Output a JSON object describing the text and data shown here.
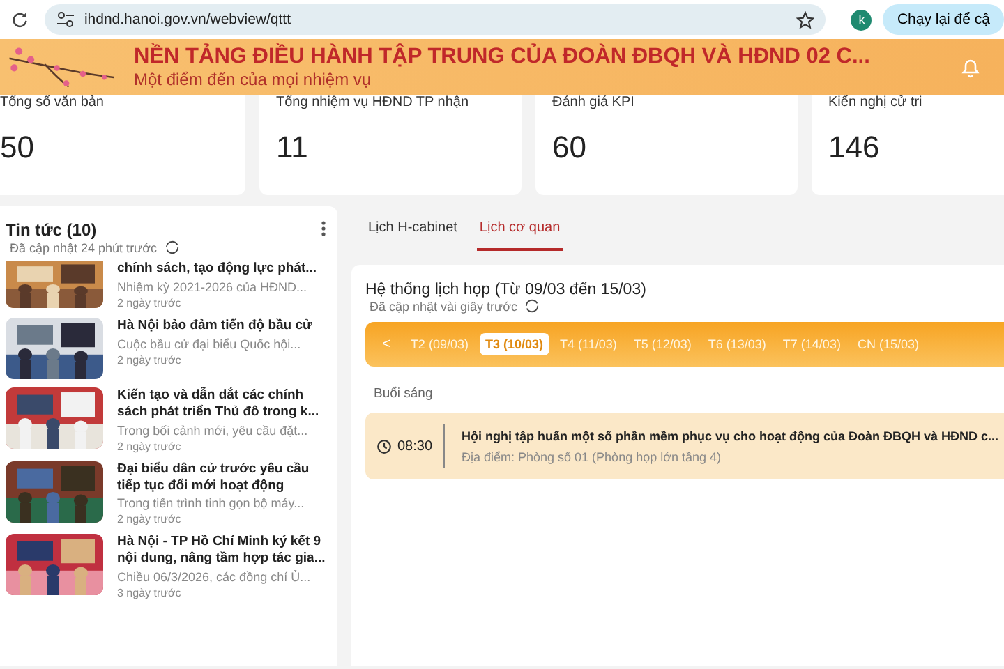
{
  "browser": {
    "url": "ihdnd.hanoi.gov.vn/webview/qttt",
    "avatar": "k",
    "action": "Chạy lại để cậ"
  },
  "header": {
    "title": "NỀN TẢNG ĐIỀU HÀNH TẬP TRUNG CỦA ĐOÀN ĐBQH VÀ HĐND 02 C...",
    "subtitle": "Một điểm đến của mọi nhiệm vụ"
  },
  "stats": [
    {
      "label": "Tổng số văn bản",
      "value": "50"
    },
    {
      "label": "Tổng nhiệm vụ HĐND TP nhận",
      "value": "11"
    },
    {
      "label": "Đánh giá KPI",
      "value": "60"
    },
    {
      "label": "Kiến nghị cử tri",
      "value": "146"
    }
  ],
  "news": {
    "title": "Tin tức (10)",
    "updated": "Đã cập nhật 24 phút trước",
    "items": [
      {
        "title": "chính sách, tạo động lực phát...",
        "summary": "Nhiệm kỳ 2021-2026 của HĐND...",
        "time": "2 ngày trước",
        "kind": "picture"
      },
      {
        "title": "Hà Nội bảo đảm tiến độ bầu cử",
        "summary": "Cuộc bầu cử đại biểu Quốc hội...",
        "time": "2 ngày trước",
        "kind": "picture"
      },
      {
        "title": "Kiến tạo và dẫn dắt các chính sách phát triển Thủ đô trong k...",
        "summary": "Trong bối cảnh mới, yêu cầu đặt...",
        "time": "2 ngày trước",
        "kind": "picture"
      },
      {
        "title": "Đại biểu dân cử trước yêu cầu tiếp tục đổi mới hoạt động",
        "summary": "Trong tiến trình tinh gọn bộ máy...",
        "time": "2 ngày trước",
        "kind": "picture"
      },
      {
        "title": "Hà Nội - TP Hồ Chí Minh ký kết 9 nội dung, nâng tầm hợp tác gia...",
        "summary": "Chiều 06/3/2026, các đồng chí Ủ...",
        "time": "3 ngày trước",
        "kind": "picture"
      }
    ]
  },
  "tabs": [
    {
      "label": "Lịch H-cabinet",
      "selected": false
    },
    {
      "label": "Lịch cơ quan",
      "selected": true
    }
  ],
  "schedule": {
    "title": "Hệ thống lịch họp (Từ 09/03 đến 15/03)",
    "updated": "Đã cập nhật vài giây trước",
    "prev": "<",
    "days": [
      {
        "label": "T2 (09/03)",
        "selected": false
      },
      {
        "label": "T3 (10/03)",
        "selected": true
      },
      {
        "label": "T4 (11/03)",
        "selected": false
      },
      {
        "label": "T5 (12/03)",
        "selected": false
      },
      {
        "label": "T6 (13/03)",
        "selected": false
      },
      {
        "label": "T7 (14/03)",
        "selected": false
      },
      {
        "label": "CN (15/03)",
        "selected": false
      }
    ],
    "session": "Buổi sáng",
    "events": [
      {
        "time": "08:30",
        "title": "Hội nghị tập huấn một số phần mềm phục vụ cho hoạt động của Đoàn ĐBQH và HĐND c...",
        "location": "Địa điểm: Phòng số 01 (Phòng họp lớn tầng 4)"
      }
    ]
  }
}
